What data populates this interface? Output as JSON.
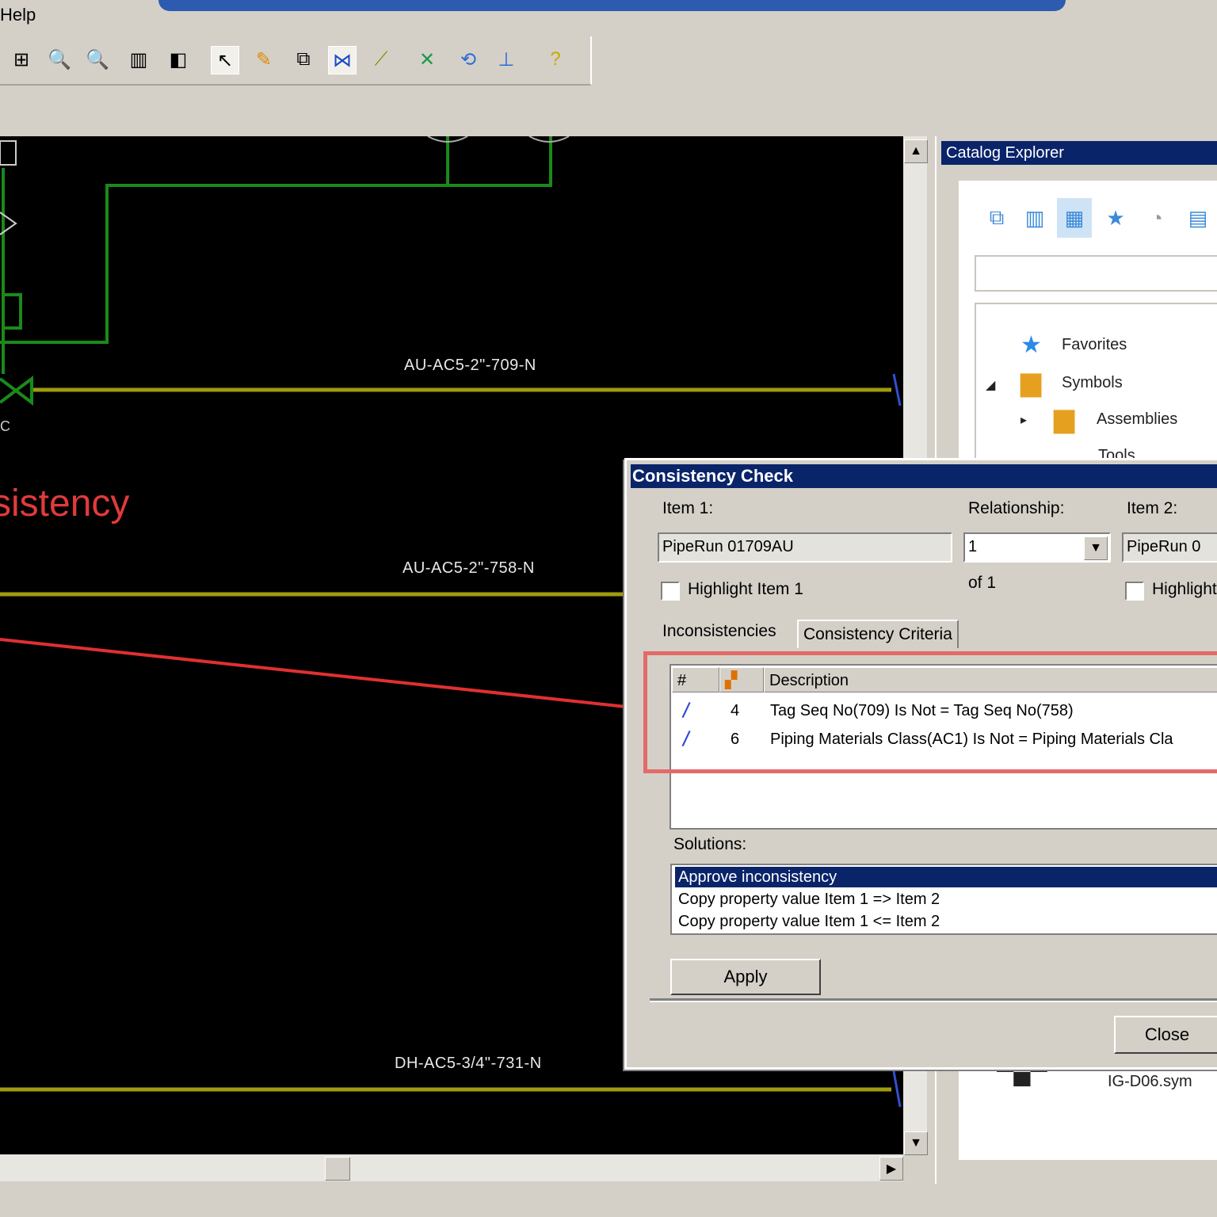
{
  "menu": {
    "help": "Help"
  },
  "toolbar": {
    "icons": [
      "zoom-window-icon",
      "zoom-in-icon",
      "zoom-out-icon",
      "fit-icon",
      "pan-icon",
      "select-icon",
      "paint-icon",
      "properties-icon",
      "link-icon",
      "connect-icon",
      "nodes-icon",
      "route-icon",
      "align-icon",
      "help-icon"
    ]
  },
  "drawing": {
    "overlay_text": "sistency",
    "pipe_labels": [
      "AU-AC5-2\"-709-N",
      "AU-AC5-2\"-758-N",
      "DH-AC5-3/4\"-731-N"
    ]
  },
  "catalog": {
    "title": "Catalog Explorer",
    "tree": [
      {
        "label": "Favorites",
        "icon": "star-icon"
      },
      {
        "label": "Symbols",
        "icon": "folder-icon"
      },
      {
        "label": "Assemblies",
        "icon": "folder-icon"
      },
      {
        "label": "Tools",
        "icon": "folder-icon"
      }
    ],
    "preview_label": "IG-D06.sym"
  },
  "dialog": {
    "title": "Consistency Check",
    "item1_label": "Item 1:",
    "relationship_label": "Relationship:",
    "item2_label": "Item 2:",
    "item1_value": "PipeRun 01709AU",
    "relationship_value": "1",
    "item2_value": "PipeRun 0",
    "of_label": "of 1",
    "highlight1": "Highlight Item 1",
    "highlight2": "Highlight",
    "tabs": [
      "Inconsistencies",
      "Consistency Criteria"
    ],
    "columns": [
      "#",
      "",
      "Description"
    ],
    "rows": [
      {
        "num": "4",
        "desc": "Tag Seq No(709) Is Not = Tag Seq No(758)"
      },
      {
        "num": "6",
        "desc": "Piping Materials Class(AC1) Is Not = Piping Materials Cla"
      }
    ],
    "solutions_label": "Solutions:",
    "solutions": [
      "Approve inconsistency",
      "Copy property value Item 1 => Item 2",
      "Copy property value Item 1 <= Item 2"
    ],
    "apply": "Apply",
    "close": "Close"
  },
  "colors": {
    "pipe": "#a09a10",
    "signal": "#1a8a1a",
    "leader": "#e03030",
    "titlebar": "#0a246a"
  }
}
